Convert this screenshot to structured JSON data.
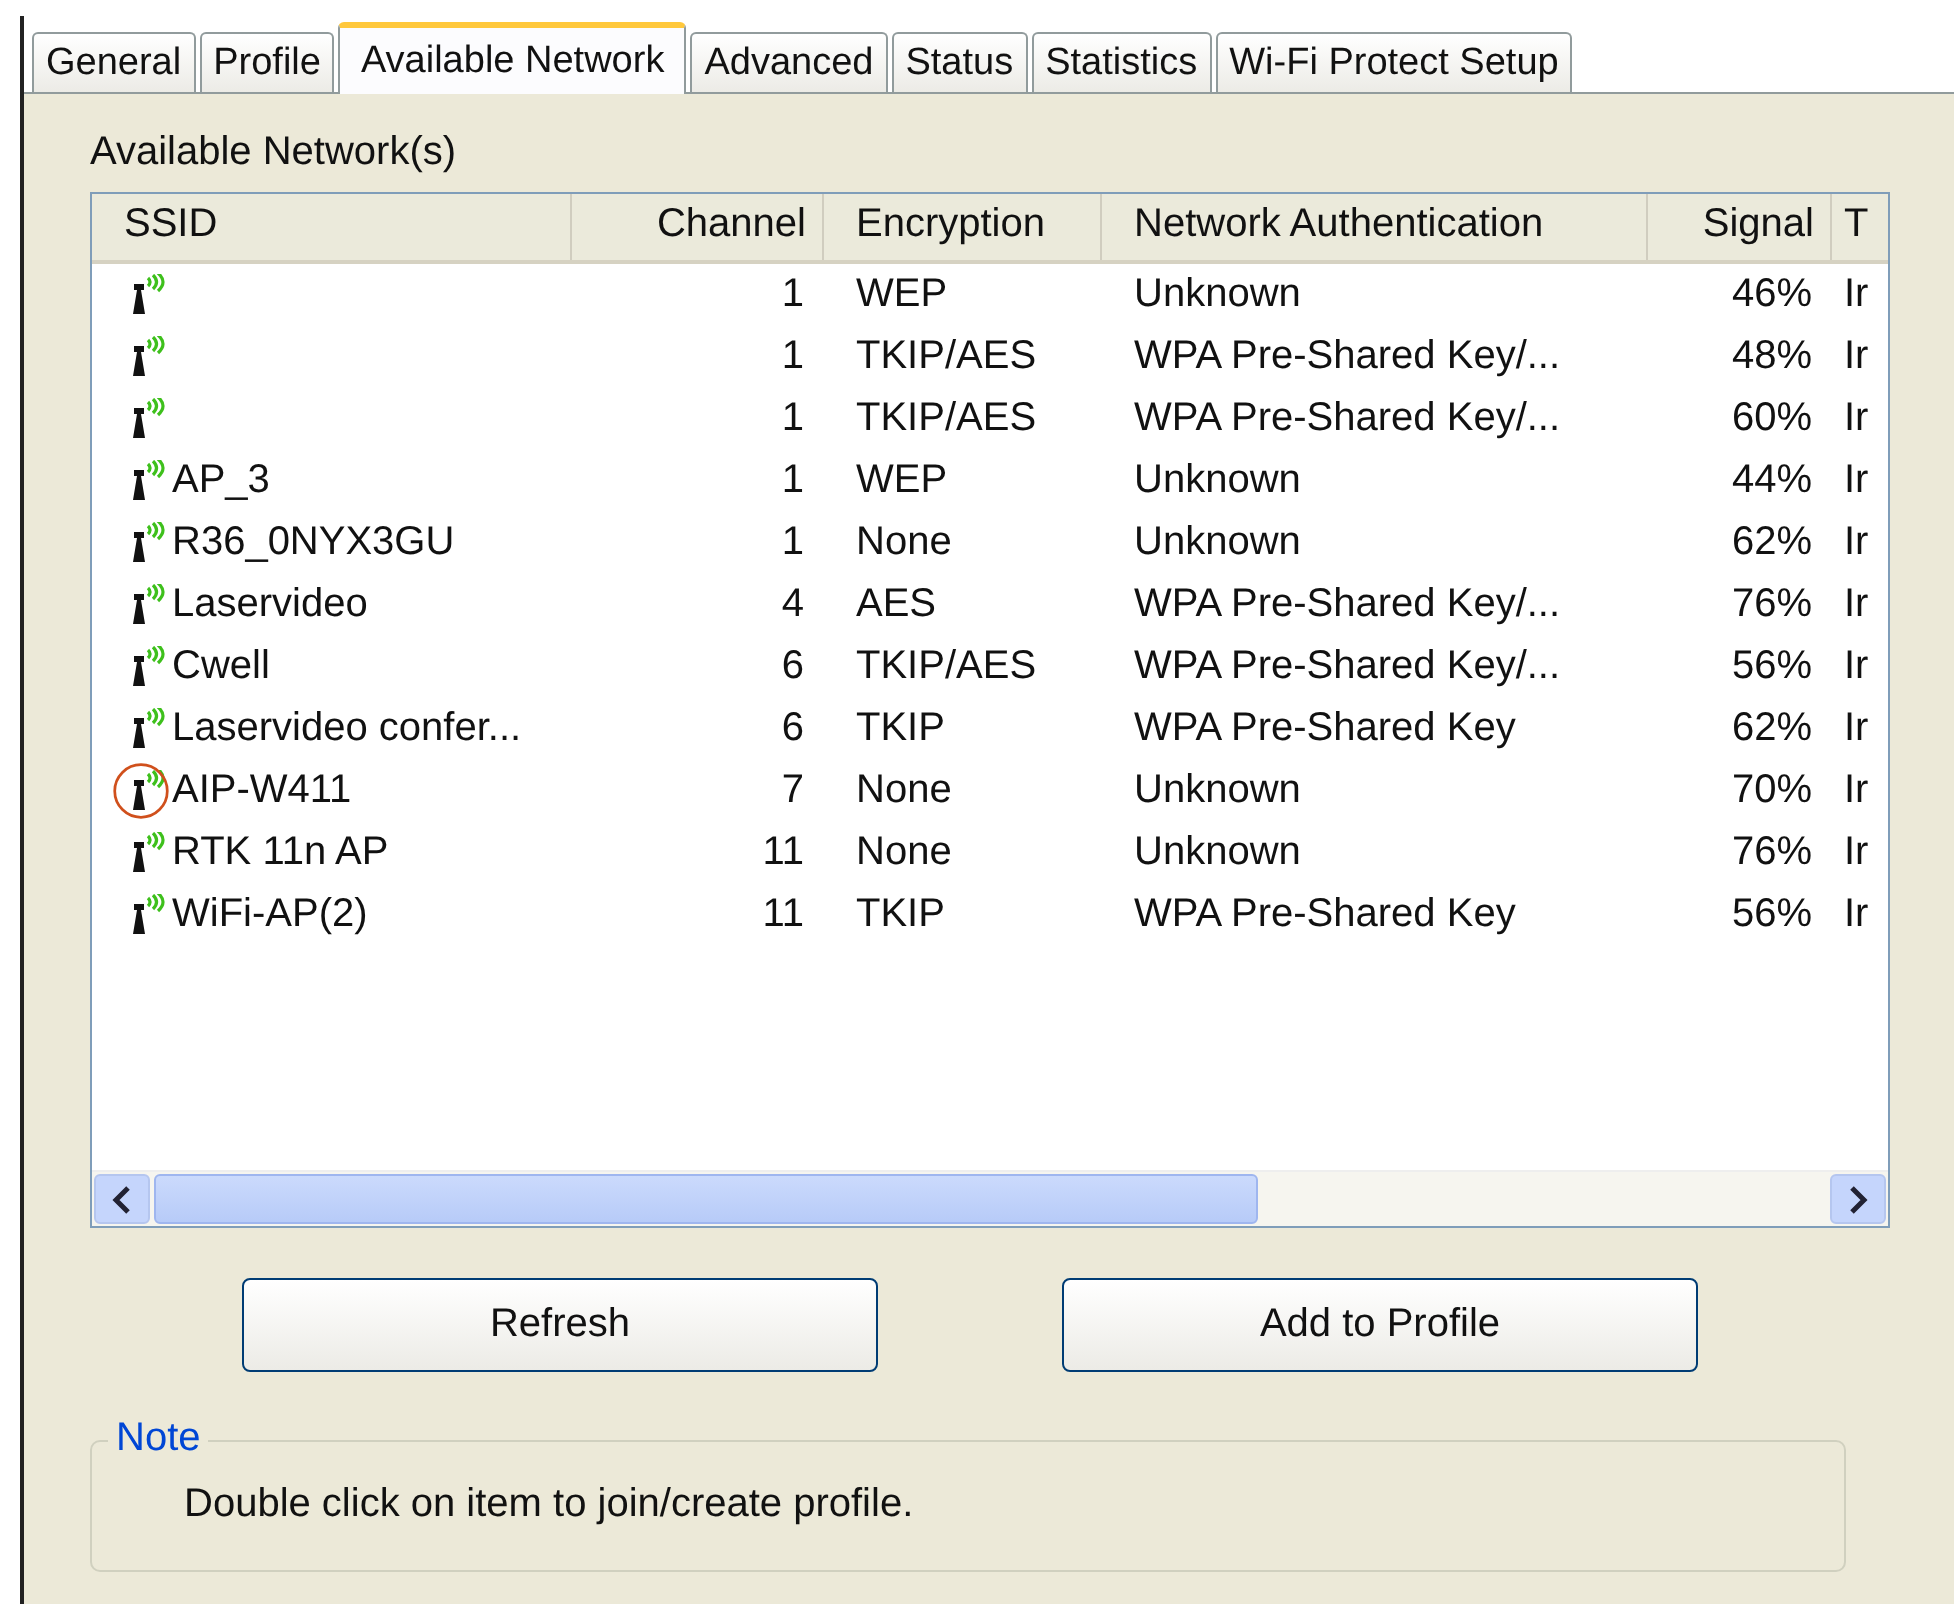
{
  "tabs": [
    {
      "label": "General",
      "selected": false
    },
    {
      "label": "Profile",
      "selected": false
    },
    {
      "label": "Available Network",
      "selected": true
    },
    {
      "label": "Advanced",
      "selected": false
    },
    {
      "label": "Status",
      "selected": false
    },
    {
      "label": "Statistics",
      "selected": false
    },
    {
      "label": "Wi-Fi Protect Setup",
      "selected": false
    }
  ],
  "section_label": "Available Network(s)",
  "table": {
    "columns": [
      "SSID",
      "Channel",
      "Encryption",
      "Network Authentication",
      "Signal",
      "T"
    ],
    "rows": [
      {
        "ssid": "",
        "channel": "1",
        "encryption": "WEP",
        "authentication": "Unknown",
        "signal": "46%",
        "column_6": "Ir",
        "circled": false
      },
      {
        "ssid": "",
        "channel": "1",
        "encryption": "TKIP/AES",
        "authentication": "WPA Pre-Shared Key/...",
        "signal": "48%",
        "column_6": "Ir",
        "circled": false
      },
      {
        "ssid": "",
        "channel": "1",
        "encryption": "TKIP/AES",
        "authentication": "WPA Pre-Shared Key/...",
        "signal": "60%",
        "column_6": "Ir",
        "circled": false
      },
      {
        "ssid": "AP_3",
        "channel": "1",
        "encryption": "WEP",
        "authentication": "Unknown",
        "signal": "44%",
        "column_6": "Ir",
        "circled": false
      },
      {
        "ssid": "R36_0NYX3GU",
        "channel": "1",
        "encryption": "None",
        "authentication": "Unknown",
        "signal": "62%",
        "column_6": "Ir",
        "circled": false
      },
      {
        "ssid": "Laservideo",
        "channel": "4",
        "encryption": "AES",
        "authentication": "WPA Pre-Shared Key/...",
        "signal": "76%",
        "column_6": "Ir",
        "circled": false
      },
      {
        "ssid": "Cwell",
        "channel": "6",
        "encryption": "TKIP/AES",
        "authentication": "WPA Pre-Shared Key/...",
        "signal": "56%",
        "column_6": "Ir",
        "circled": false
      },
      {
        "ssid": "Laservideo confer...",
        "channel": "6",
        "encryption": "TKIP",
        "authentication": "WPA Pre-Shared Key",
        "signal": "62%",
        "column_6": "Ir",
        "circled": false
      },
      {
        "ssid": "AIP-W411",
        "channel": "7",
        "encryption": "None",
        "authentication": "Unknown",
        "signal": "70%",
        "column_6": "Ir",
        "circled": true
      },
      {
        "ssid": "RTK 11n AP",
        "channel": "11",
        "encryption": "None",
        "authentication": "Unknown",
        "signal": "76%",
        "column_6": "Ir",
        "circled": false
      },
      {
        "ssid": "WiFi-AP(2)",
        "channel": "11",
        "encryption": "TKIP",
        "authentication": "WPA Pre-Shared Key",
        "signal": "56%",
        "column_6": "Ir",
        "circled": false
      }
    ]
  },
  "buttons": [
    "Refresh",
    "Add to Profile"
  ],
  "note": {
    "title": "Note",
    "text": "Double click on item to join/create profile."
  }
}
